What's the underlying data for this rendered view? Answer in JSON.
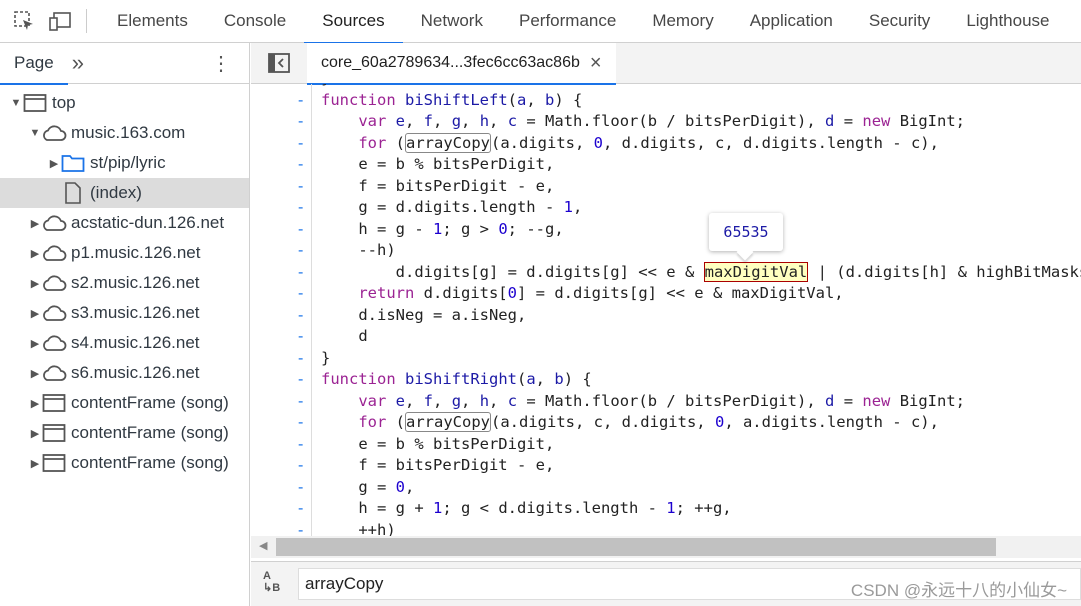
{
  "toolbar": {
    "icons": [
      "inspect-element-icon",
      "device-toolbar-icon"
    ],
    "tabs": [
      "Elements",
      "Console",
      "Sources",
      "Network",
      "Performance",
      "Memory",
      "Application",
      "Security",
      "Lighthouse"
    ],
    "active": "Sources"
  },
  "navigator": {
    "tab": "Page",
    "more": "»",
    "tree": [
      {
        "label": "top",
        "icon": "frame",
        "depth": 0,
        "expanded": true
      },
      {
        "label": "music.163.com",
        "icon": "cloud",
        "depth": 1,
        "expanded": true
      },
      {
        "label": "st/pip/lyric",
        "icon": "folder",
        "depth": 2,
        "expanded": false
      },
      {
        "label": "(index)",
        "icon": "file",
        "depth": 2,
        "selected": true
      },
      {
        "label": "acstatic-dun.126.net",
        "icon": "cloud",
        "depth": 1,
        "expanded": false
      },
      {
        "label": "p1.music.126.net",
        "icon": "cloud",
        "depth": 1,
        "expanded": false
      },
      {
        "label": "s2.music.126.net",
        "icon": "cloud",
        "depth": 1,
        "expanded": false
      },
      {
        "label": "s3.music.126.net",
        "icon": "cloud",
        "depth": 1,
        "expanded": false
      },
      {
        "label": "s4.music.126.net",
        "icon": "cloud",
        "depth": 1,
        "expanded": false
      },
      {
        "label": "s6.music.126.net",
        "icon": "cloud",
        "depth": 1,
        "expanded": false
      },
      {
        "label": "contentFrame (song)",
        "icon": "frame",
        "depth": 1,
        "expanded": false
      },
      {
        "label": "contentFrame (song)",
        "icon": "frame",
        "depth": 1,
        "expanded": false
      },
      {
        "label": "contentFrame (song)",
        "icon": "frame",
        "depth": 1,
        "expanded": false
      }
    ]
  },
  "file_tab": {
    "name": "core_60a2789634...3fec6cc63ac86b",
    "close": "×"
  },
  "editor": {
    "gutter_mark": "-",
    "lines": [
      [
        [
          "p",
          "}"
        ]
      ],
      [
        [
          "kw",
          "function "
        ],
        [
          "fn",
          "biShiftLeft"
        ],
        [
          "p",
          "("
        ],
        [
          "vr",
          "a"
        ],
        [
          "p",
          ", "
        ],
        [
          "vr",
          "b"
        ],
        [
          "p",
          ") {"
        ]
      ],
      [
        [
          "p",
          "    "
        ],
        [
          "kw",
          "var "
        ],
        [
          "vr",
          "e"
        ],
        [
          "p",
          ", "
        ],
        [
          "vr",
          "f"
        ],
        [
          "p",
          ", "
        ],
        [
          "vr",
          "g"
        ],
        [
          "p",
          ", "
        ],
        [
          "vr",
          "h"
        ],
        [
          "p",
          ", "
        ],
        [
          "vr",
          "c"
        ],
        [
          "p",
          " = Math.floor(b / bitsPerDigit), "
        ],
        [
          "vr",
          "d"
        ],
        [
          "p",
          " = "
        ],
        [
          "kw",
          "new "
        ],
        [
          "p",
          "BigInt;"
        ]
      ],
      [
        [
          "p",
          "    "
        ],
        [
          "kw",
          "for "
        ],
        [
          "p",
          "("
        ],
        [
          "box",
          "arrayCopy"
        ],
        [
          "p",
          "(a.digits, "
        ],
        [
          "num",
          "0"
        ],
        [
          "p",
          ", d.digits, c, d.digits.length - c),"
        ]
      ],
      [
        [
          "p",
          "    e = b % bitsPerDigit,"
        ]
      ],
      [
        [
          "p",
          "    f = bitsPerDigit - e,"
        ]
      ],
      [
        [
          "p",
          "    g = d.digits.length - "
        ],
        [
          "num",
          "1"
        ],
        [
          "p",
          ","
        ]
      ],
      [
        [
          "p",
          "    h = g - "
        ],
        [
          "num",
          "1"
        ],
        [
          "p",
          "; g > "
        ],
        [
          "num",
          "0"
        ],
        [
          "p",
          "; --g,"
        ]
      ],
      [
        [
          "p",
          "    --h)"
        ]
      ],
      [
        [
          "p",
          "        d.digits[g] = d.digits[g] << e & "
        ],
        [
          "hl",
          "maxDigitVal"
        ],
        [
          "p",
          " | (d.digits[h] & highBitMasks[e]) >>> f;"
        ]
      ],
      [
        [
          "p",
          "    "
        ],
        [
          "kw",
          "return "
        ],
        [
          "p",
          "d.digits["
        ],
        [
          "num",
          "0"
        ],
        [
          "p",
          "] = d.digits[g] << e & maxDigitVal,"
        ]
      ],
      [
        [
          "p",
          "    d.isNeg = a.isNeg,"
        ]
      ],
      [
        [
          "p",
          "    d"
        ]
      ],
      [
        [
          "p",
          "}"
        ]
      ],
      [
        [
          "kw",
          "function "
        ],
        [
          "fn",
          "biShiftRight"
        ],
        [
          "p",
          "("
        ],
        [
          "vr",
          "a"
        ],
        [
          "p",
          ", "
        ],
        [
          "vr",
          "b"
        ],
        [
          "p",
          ") {"
        ]
      ],
      [
        [
          "p",
          "    "
        ],
        [
          "kw",
          "var "
        ],
        [
          "vr",
          "e"
        ],
        [
          "p",
          ", "
        ],
        [
          "vr",
          "f"
        ],
        [
          "p",
          ", "
        ],
        [
          "vr",
          "g"
        ],
        [
          "p",
          ", "
        ],
        [
          "vr",
          "h"
        ],
        [
          "p",
          ", "
        ],
        [
          "vr",
          "c"
        ],
        [
          "p",
          " = Math.floor(b / bitsPerDigit), "
        ],
        [
          "vr",
          "d"
        ],
        [
          "p",
          " = "
        ],
        [
          "kw",
          "new "
        ],
        [
          "p",
          "BigInt;"
        ]
      ],
      [
        [
          "p",
          "    "
        ],
        [
          "kw",
          "for "
        ],
        [
          "p",
          "("
        ],
        [
          "box",
          "arrayCopy"
        ],
        [
          "p",
          "(a.digits, c, d.digits, "
        ],
        [
          "num",
          "0"
        ],
        [
          "p",
          ", a.digits.length - c),"
        ]
      ],
      [
        [
          "p",
          "    e = b % bitsPerDigit,"
        ]
      ],
      [
        [
          "p",
          "    f = bitsPerDigit - e,"
        ]
      ],
      [
        [
          "p",
          "    g = "
        ],
        [
          "num",
          "0"
        ],
        [
          "p",
          ","
        ]
      ],
      [
        [
          "p",
          "    h = g + "
        ],
        [
          "num",
          "1"
        ],
        [
          "p",
          "; g < d.digits.length - "
        ],
        [
          "num",
          "1"
        ],
        [
          "p",
          "; ++g,"
        ]
      ],
      [
        [
          "p",
          "    ++h)"
        ]
      ]
    ],
    "tooltip": "65535"
  },
  "search": {
    "value": "arrayCopy",
    "icon": "case-sensitive-icon"
  },
  "watermark": "CSDN @永远十八的小仙女~"
}
